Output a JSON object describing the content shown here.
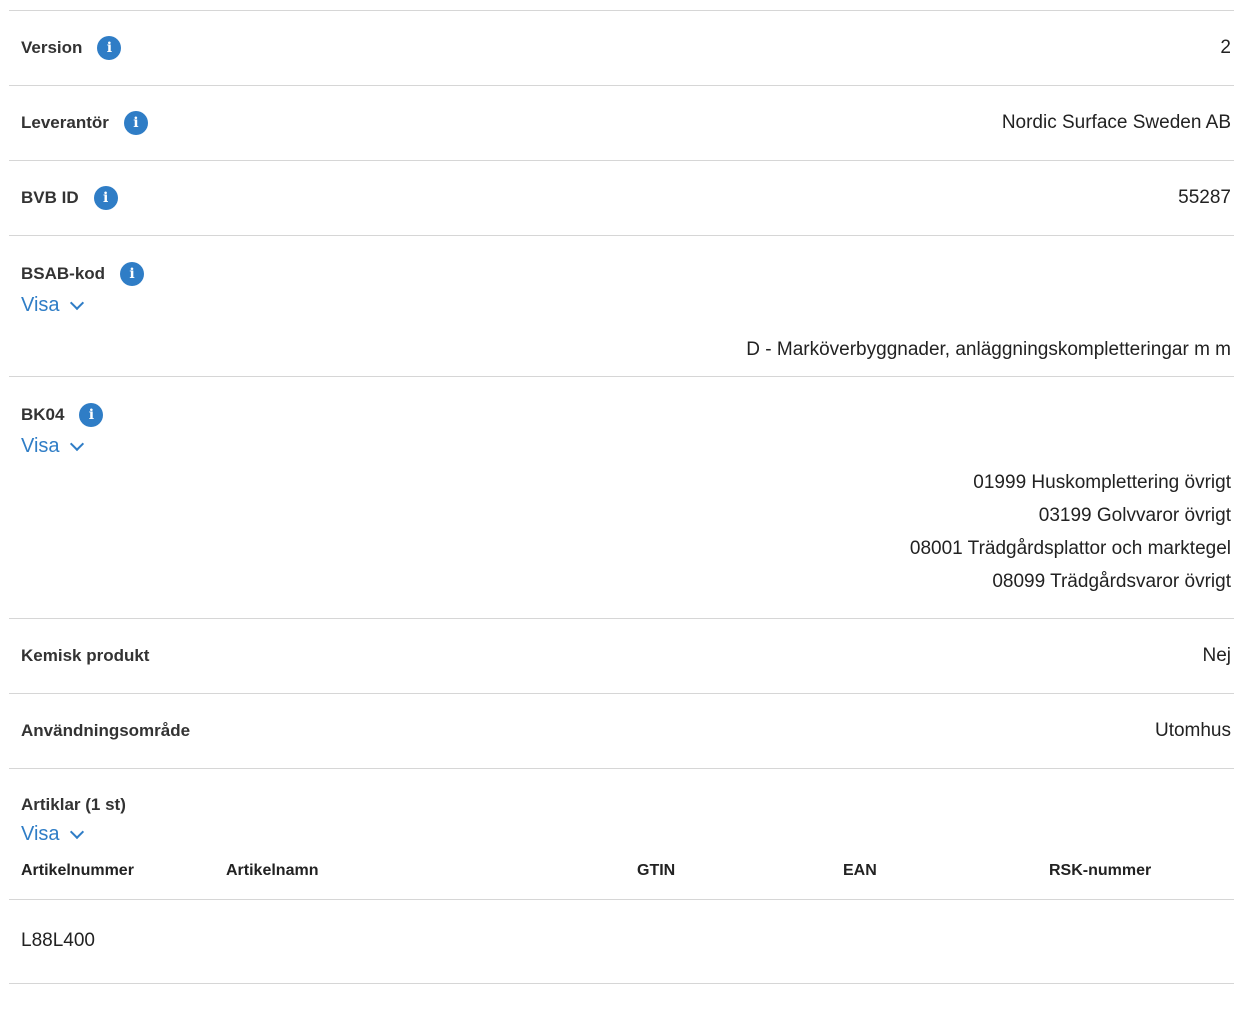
{
  "rows": {
    "version": {
      "label": "Version",
      "value": "2"
    },
    "supplier": {
      "label": "Leverantör",
      "value": "Nordic Surface Sweden AB"
    },
    "bvb_id": {
      "label": "BVB ID",
      "value": "55287"
    },
    "bsab": {
      "label": "BSAB-kod",
      "toggle": "Visa",
      "values": [
        "D - Marköverbyggnader, anläggningskompletteringar m m"
      ]
    },
    "bk04": {
      "label": "BK04",
      "toggle": "Visa",
      "values": [
        "01999 Huskomplettering övrigt",
        "03199 Golvvaror övrigt",
        "08001 Trädgårdsplattor och marktegel",
        "08099 Trädgårdsvaror övrigt"
      ]
    },
    "chemical": {
      "label": "Kemisk produkt",
      "value": "Nej"
    },
    "usage": {
      "label": "Användningsområde",
      "value": "Utomhus"
    }
  },
  "articles": {
    "label": "Artiklar (1 st)",
    "toggle": "Visa",
    "columns": [
      "Artikelnummer",
      "Artikelnamn",
      "GTIN",
      "EAN",
      "RSK-nummer"
    ],
    "rows": [
      [
        "L88L400",
        "",
        "",
        "",
        ""
      ]
    ]
  },
  "colors": {
    "accent": "#2f7dc6",
    "divider": "#d6d6d6",
    "text": "#222222"
  },
  "icons": {
    "info": "info-icon",
    "chevron": "chevron-down-icon"
  }
}
